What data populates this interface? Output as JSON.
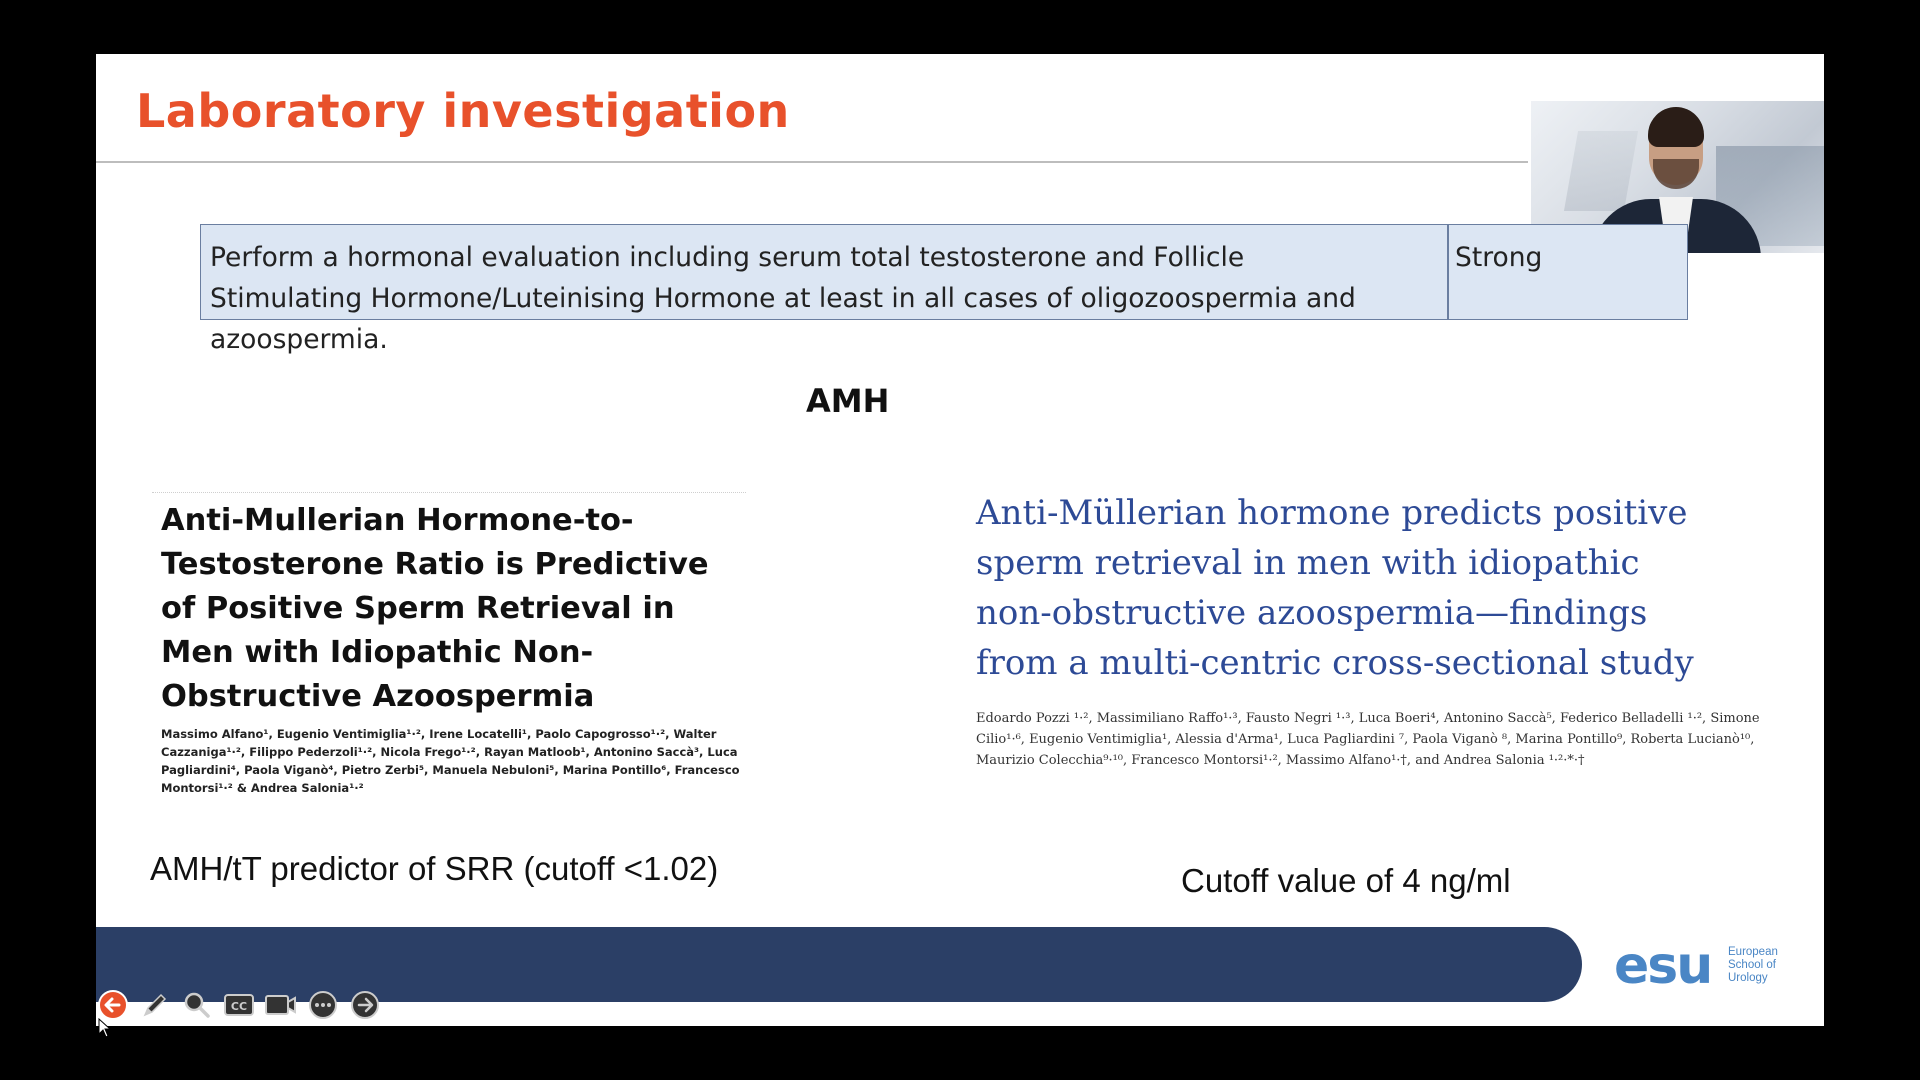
{
  "slide": {
    "title": "Laboratory investigation",
    "recommendation": {
      "text": "Perform a hormonal evaluation including serum total testosterone and Follicle Stimulating Hormone/Luteinising Hormone at least in all cases of oligozoospermia and azoospermia.",
      "strength": "Strong"
    },
    "section_heading": "AMH",
    "paper_left": {
      "title": "Anti-Mullerian Hormone-to-Testosterone Ratio is Predictive of Positive Sperm Retrieval in Men with Idiopathic Non-Obstructive Azoospermia",
      "authors": "Massimo Alfano¹, Eugenio Ventimiglia¹·², Irene Locatelli¹, Paolo Capogrosso¹·², Walter Cazzaniga¹·², Filippo Pederzoli¹·², Nicola Frego¹·², Rayan Matloob¹, Antonino Saccà³, Luca Pagliardini⁴, Paola Viganò⁴, Pietro Zerbi⁵, Manuela Nebuloni⁵, Marina Pontillo⁶, Francesco Montorsi¹·² & Andrea Salonia¹·²",
      "caption": "AMH/tT predictor of SRR (cutoff <1.02)"
    },
    "paper_right": {
      "title": "Anti-Müllerian hormone predicts positive sperm retrieval in men with idiopathic non-obstructive azoospermia—findings from a multi-centric cross-sectional study",
      "authors": "Edoardo Pozzi ¹·², Massimiliano Raffo¹·³, Fausto Negri ¹·³, Luca Boeri⁴, Antonino Saccà⁵, Federico Belladelli ¹·², Simone Cilio¹·⁶, Eugenio Ventimiglia¹, Alessia d'Arma¹, Luca Pagliardini ⁷, Paola Viganò ⁸, Marina Pontillo⁹, Roberta Lucianò¹⁰, Maurizio Colecchia⁹·¹⁰, Francesco Montorsi¹·², Massimo Alfano¹·†, and Andrea Salonia ¹·²·*·†",
      "caption": "Cutoff value of 4 ng/ml"
    },
    "logo": {
      "mark": "esu",
      "line1": "European",
      "line2": "School of",
      "line3": "Urology"
    }
  },
  "toolbar": {
    "tools": [
      "back-arrow-icon",
      "pen-icon",
      "zoom-icon",
      "captions-icon",
      "camera-icon",
      "more-icon",
      "forward-arrow-icon"
    ],
    "captions_label": "CC"
  },
  "colors": {
    "title": "#e8512b",
    "box_fill": "#dce6f3",
    "box_border": "#6a7ea0",
    "paper_right_title": "#2d4a96",
    "footer_bar": "#2b3f66",
    "logo": "#4a86c5",
    "back_button": "#e8512b"
  }
}
